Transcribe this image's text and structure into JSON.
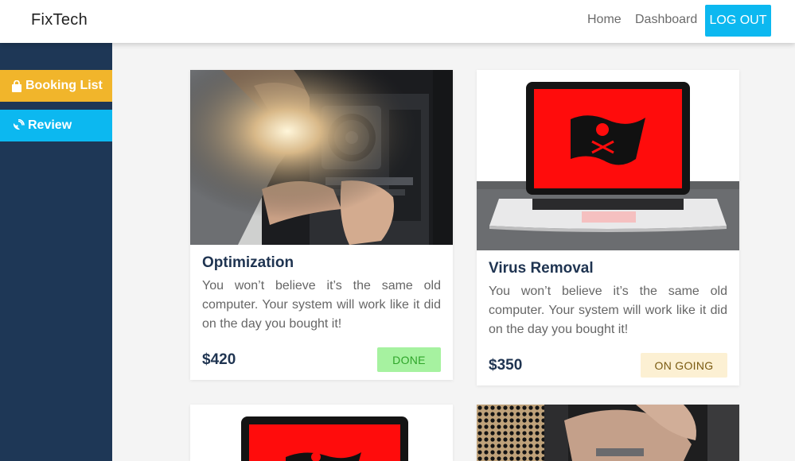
{
  "navbar": {
    "brand": "FixTech",
    "links": [
      "Home",
      "Dashboard"
    ],
    "logout_label": "LOG OUT"
  },
  "sidebar": {
    "items": [
      {
        "label": "Booking List",
        "icon": "shopping-bag-icon",
        "color": "#f1b52b"
      },
      {
        "label": "Review",
        "icon": "satellite-dish-icon",
        "color": "#0cb8f0"
      }
    ]
  },
  "services": [
    {
      "title": "Optimization",
      "description": "You won’t believe it’s the same old computer. Your system will work like it did on the day you bought it!",
      "price": "$420",
      "status": "DONE",
      "image": "technician-repairing-pc-photo"
    },
    {
      "title": "Virus Removal",
      "description": "You won’t believe it’s the same old computer. Your system will work like it did on the day you bought it!",
      "price": "$350",
      "status": "ON GOING",
      "image": "laptop-pirate-flag-photo"
    },
    {
      "image": "laptop-pirate-flag-photo"
    },
    {
      "image": "computer-hardware-photo"
    }
  ],
  "colors": {
    "sidebar_bg": "#1e3756",
    "accent_blue": "#0cb8f0",
    "accent_yellow": "#f1b52b",
    "done_bg": "#a6f2a0",
    "ongoing_bg": "#fcf0d3"
  }
}
